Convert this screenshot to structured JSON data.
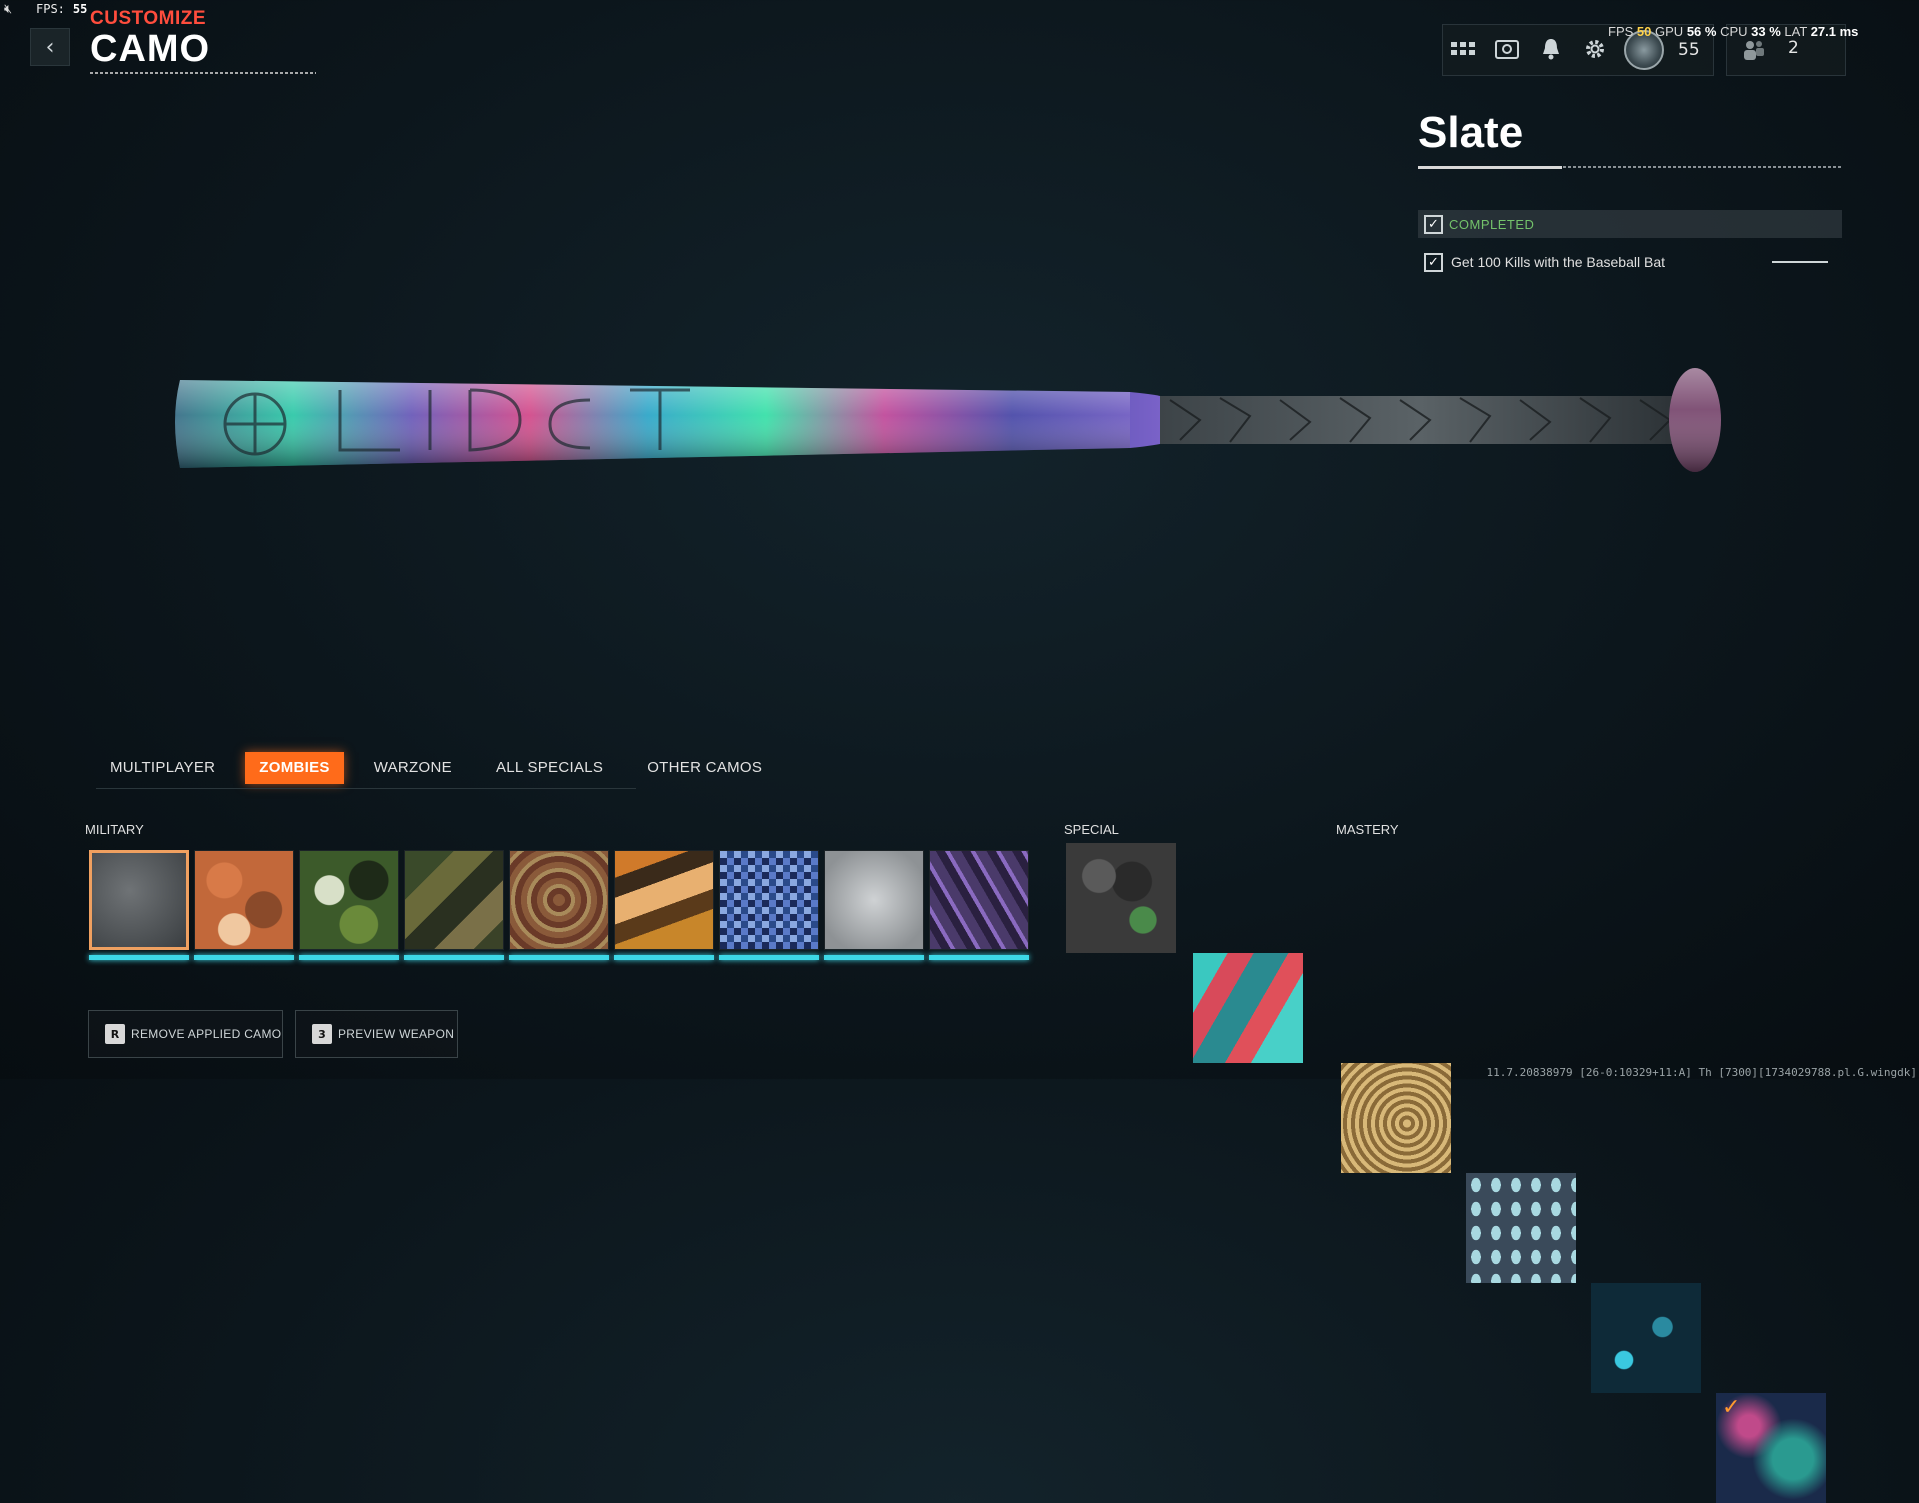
{
  "overlay": {
    "fps_label": "FPS:",
    "fps_value": "55"
  },
  "header": {
    "breadcrumb": "CUSTOMIZE",
    "title": "CAMO"
  },
  "hud": {
    "stats": {
      "fps_label": "FPS",
      "fps": "50",
      "gpu_label": "GPU",
      "gpu": "56 %",
      "cpu_label": "CPU",
      "cpu": "33 %",
      "lat_label": "LAT",
      "lat": "27.1 ms"
    },
    "level": "55",
    "party_count": "2"
  },
  "camo": {
    "name": "Slate",
    "status": "COMPLETED",
    "challenge": "Get 100 Kills with the Baseball Bat"
  },
  "tabs": [
    {
      "label": "MULTIPLAYER",
      "active": false
    },
    {
      "label": "ZOMBIES",
      "active": true
    },
    {
      "label": "WARZONE",
      "active": false
    },
    {
      "label": "ALL SPECIALS",
      "active": false
    },
    {
      "label": "OTHER CAMOS",
      "active": false
    }
  ],
  "sections": {
    "military": "MILITARY",
    "special": "SPECIAL",
    "mastery": "MASTERY"
  },
  "buttons": {
    "remove": {
      "key": "R",
      "label": "REMOVE APPLIED CAMO"
    },
    "preview": {
      "key": "3",
      "label": "PREVIEW WEAPON"
    }
  },
  "version": "11.7.20838979 [26-0:10329+11:A] Th [7300][1734029788.pl.G.wingdk]",
  "colors": {
    "accent": "#ff6b1a",
    "breadcrumb": "#ff4d3d",
    "completed": "#73c26a",
    "progress": "#3dd7e6"
  }
}
